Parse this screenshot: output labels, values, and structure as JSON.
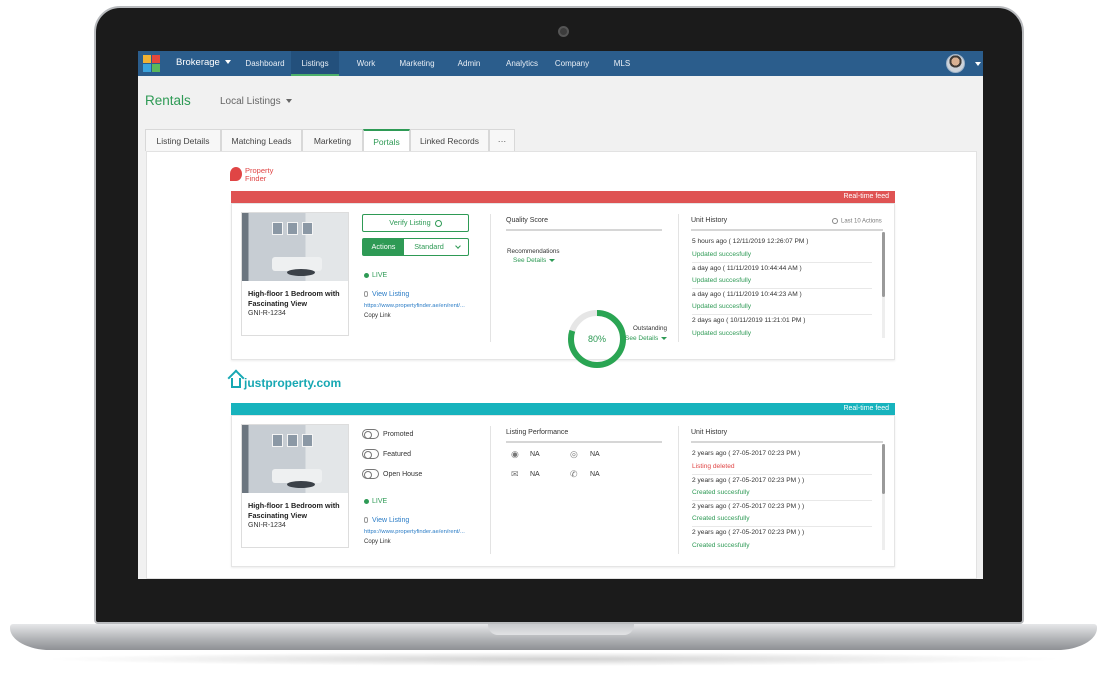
{
  "nav": {
    "brokerage": "Brokerage",
    "items": [
      {
        "label": "Dashboard"
      },
      {
        "label": "Listings"
      },
      {
        "label": "Work"
      },
      {
        "label": "Marketing"
      },
      {
        "label": "Admin"
      },
      {
        "label": "Analytics"
      },
      {
        "label": "Company"
      },
      {
        "label": "MLS"
      }
    ],
    "active_item": "Listings"
  },
  "header": {
    "title": "Rentals",
    "dropdown": "Local Listings"
  },
  "tabs": [
    {
      "label": "Listing Details"
    },
    {
      "label": "Matching Leads"
    },
    {
      "label": "Marketing"
    },
    {
      "label": "Portals"
    },
    {
      "label": "Linked Records"
    },
    {
      "label": "···"
    }
  ],
  "active_tab": "Portals",
  "portal1": {
    "logo_line1": "Property",
    "logo_line2": "Finder",
    "feed": "Real-time feed",
    "feed_color": "#df5353",
    "listing_title": "High-floor 1 Bedroom with Fascinating View",
    "listing_code": "GNI-R-1234",
    "verify_label": "Verify Listing",
    "actions_label": "Actions",
    "standard_label": "Standard",
    "live": "LIVE",
    "view_listing": "View Listing",
    "url": "https://www.propertyfinder.ae/en/rent/...",
    "copy_link": "Copy Link",
    "quality_title": "Quality Score",
    "recommendations": "Recommendations",
    "see_details": "See Details",
    "score_value": 0.8,
    "score_label": "80%",
    "outstanding": "Outstanding",
    "history_title": "Unit History",
    "history_filter": "Last 10 Actions",
    "history": [
      {
        "time": "5 hours ago ( 12/11/2019 12:26:07 PM )",
        "status": "Updated succesfully"
      },
      {
        "time": "a day ago ( 11/11/2019 10:44:44 AM )",
        "status": "Updated succesfully"
      },
      {
        "time": "a day ago ( 11/11/2019 10:44:23 AM )",
        "status": "Updated succesfully"
      },
      {
        "time": "2 days ago ( 10/11/2019 11:21:01 PM )",
        "status": "Updated succesfully"
      }
    ]
  },
  "portal2": {
    "logo": "justproperty.com",
    "feed": "Real-time feed",
    "feed_color": "#17b3bd",
    "listing_title": "High-floor 1 Bedroom with Fascinating View",
    "listing_code": "GNI-R-1234",
    "toggles": [
      {
        "label": "Promoted"
      },
      {
        "label": "Featured"
      },
      {
        "label": "Open House"
      }
    ],
    "live": "LIVE",
    "view_listing": "View Listing",
    "url": "https://www.propertyfinder.ae/en/rent/...",
    "copy_link": "Copy Link",
    "perf_title": "Listing Performance",
    "perf": [
      {
        "icon": "eye-icon",
        "value": "NA"
      },
      {
        "icon": "target-icon",
        "value": "NA"
      },
      {
        "icon": "mail-icon",
        "value": "NA"
      },
      {
        "icon": "phone-icon",
        "value": "NA"
      }
    ],
    "history_title": "Unit History",
    "history": [
      {
        "time": "2 years ago ( 27-05-2017 02:23 PM )",
        "status": "Listing deleted"
      },
      {
        "time": "2 years ago ( 27-05-2017 02:23 PM ) )",
        "status": "Created succesfully"
      },
      {
        "time": "2 years ago ( 27-05-2017 02:23 PM ) )",
        "status": "Created succesfully"
      },
      {
        "time": "2 years ago ( 27-05-2017 02:23 PM ) )",
        "status": "Created succesfully"
      }
    ]
  },
  "colors": {
    "accent": "#2e9a55",
    "nav_bg": "#2b5d8c"
  }
}
